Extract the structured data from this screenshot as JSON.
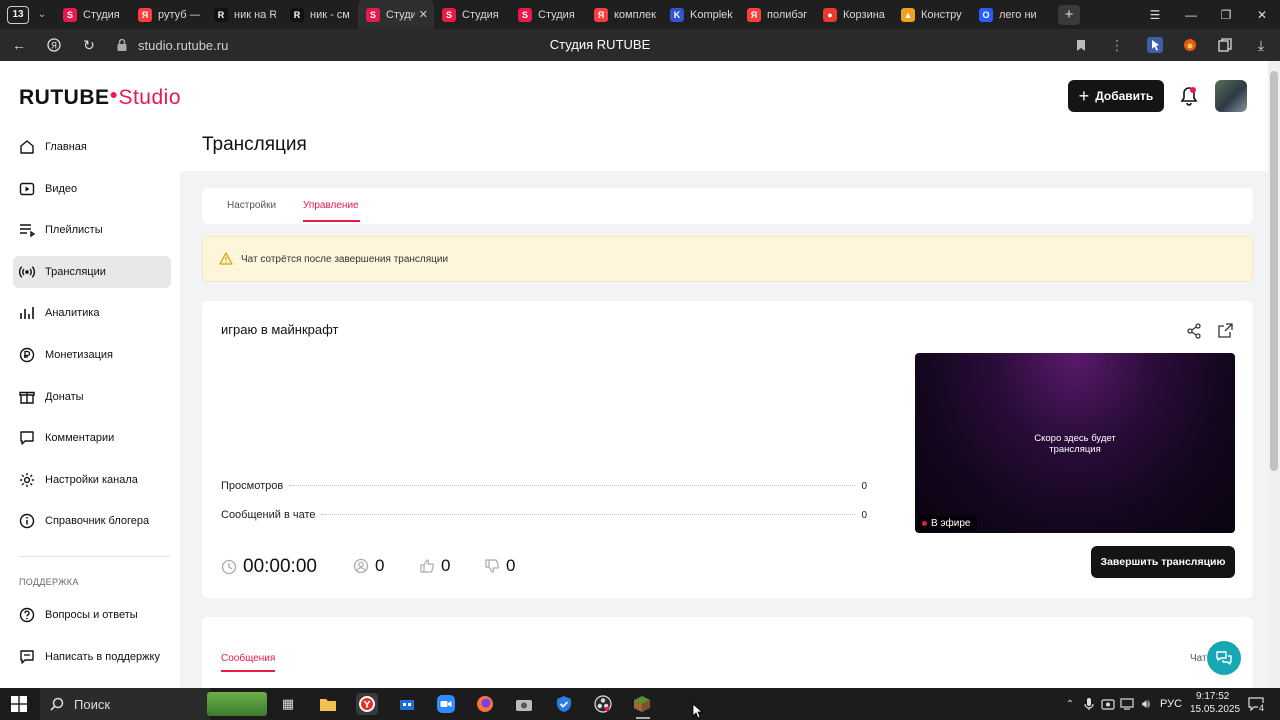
{
  "browser": {
    "tab_count": "13",
    "tabs": [
      {
        "title": "Студия",
        "icon": "rutube-favicon",
        "color": "#e8194b",
        "letter": "S"
      },
      {
        "title": "рутуб —",
        "icon": "yandex-favicon",
        "color": "#ff3d3d",
        "letter": "Я"
      },
      {
        "title": "ник на R",
        "icon": "rutube-r-favicon",
        "color": "#111111",
        "letter": "R"
      },
      {
        "title": "ник - см",
        "icon": "rutube-r-favicon",
        "color": "#111111",
        "letter": "R"
      },
      {
        "title": "Студи",
        "icon": "rutube-favicon",
        "color": "#e8194b",
        "letter": "S",
        "active": true
      },
      {
        "title": "Студия",
        "icon": "rutube-favicon",
        "color": "#e8194b",
        "letter": "S"
      },
      {
        "title": "Студия",
        "icon": "rutube-favicon",
        "color": "#e8194b",
        "letter": "S"
      },
      {
        "title": "комплек",
        "icon": "yandex-favicon",
        "color": "#ff3d3d",
        "letter": "Я"
      },
      {
        "title": "Komplek",
        "icon": "km-favicon",
        "color": "#3355cc",
        "letter": "K"
      },
      {
        "title": "полибэг",
        "icon": "yandex-favicon",
        "color": "#ff3d3d",
        "letter": "Я"
      },
      {
        "title": "Корзина",
        "icon": "market-favicon",
        "color": "#e63b2e",
        "letter": "●"
      },
      {
        "title": "Констру",
        "icon": "fire-favicon",
        "color": "#f0a020",
        "letter": "▲"
      },
      {
        "title": "лего ни",
        "icon": "ozon-favicon",
        "color": "#2b5cff",
        "letter": "O"
      }
    ],
    "url": "studio.rutube.ru",
    "page_title": "Студия RUTUBE"
  },
  "header": {
    "logo_main": "RUTUBE",
    "logo_sub": "Studio",
    "add_label": "Добавить"
  },
  "sidebar": {
    "items": [
      {
        "label": "Главная",
        "icon": "home-icon"
      },
      {
        "label": "Видео",
        "icon": "video-icon"
      },
      {
        "label": "Плейлисты",
        "icon": "playlist-icon"
      },
      {
        "label": "Трансляции",
        "icon": "broadcast-icon",
        "active": true
      },
      {
        "label": "Аналитика",
        "icon": "analytics-icon"
      },
      {
        "label": "Монетизация",
        "icon": "monetization-icon"
      },
      {
        "label": "Донаты",
        "icon": "donate-icon"
      },
      {
        "label": "Комментарии",
        "icon": "comment-icon"
      },
      {
        "label": "Настройки канала",
        "icon": "gear-icon"
      },
      {
        "label": "Справочник блогера",
        "icon": "info-icon"
      }
    ],
    "support_header": "ПОДДЕРЖКА",
    "support_items": [
      {
        "label": "Вопросы и ответы",
        "icon": "question-icon"
      },
      {
        "label": "Написать в поддержку",
        "icon": "chat-icon"
      }
    ]
  },
  "main": {
    "page_title": "Трансляция",
    "tabs": [
      {
        "label": "Настройки"
      },
      {
        "label": "Управление",
        "selected": true
      }
    ],
    "warning": "Чат сотрётся после завершения трансляции",
    "stream_title": "играю в майнкрафт",
    "stats": [
      {
        "label": "Просмотров",
        "value": "0"
      },
      {
        "label": "Сообщений в чате",
        "value": "0"
      }
    ],
    "preview_text_1": "Скоро здесь будет",
    "preview_text_2": "трансляция",
    "live_label": "В эфире",
    "timer": "00:00:00",
    "viewers": "0",
    "likes": "0",
    "dislikes": "0",
    "end_button": "Завершить трансляцию",
    "messages_tab": "Сообщения",
    "chat_tab": "Чат"
  },
  "taskbar": {
    "search_label": "Поиск",
    "lang": "РУС",
    "time": "9:17:52",
    "date": "15.05.2025",
    "notifications": "4"
  },
  "colors": {
    "accent": "#e8194b",
    "dark": "#141414",
    "warning_bg": "#fdf6dc",
    "help": "#18a7b5"
  }
}
